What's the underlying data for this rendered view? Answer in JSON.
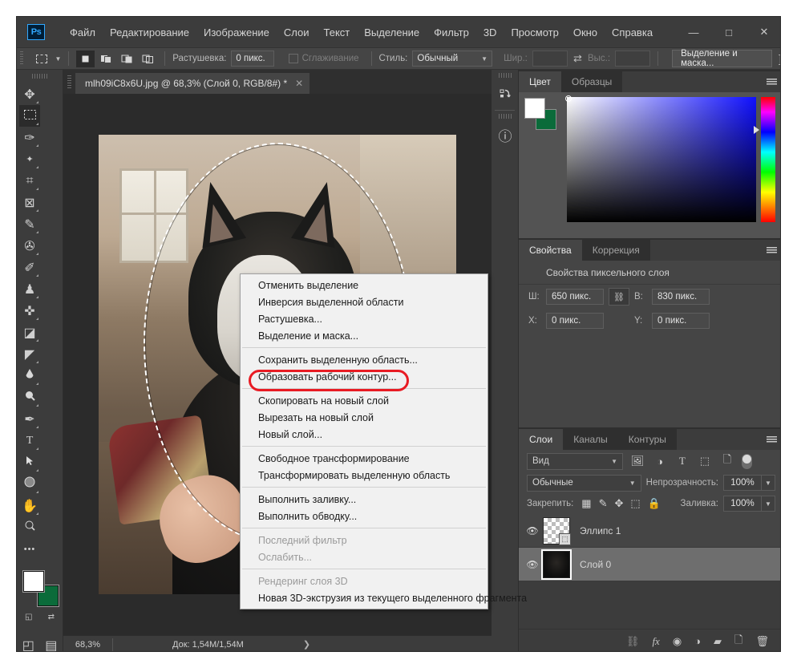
{
  "window": {
    "app_name": "Ps",
    "minimize": "—",
    "maximize": "□",
    "close": "✕"
  },
  "menubar": {
    "items": [
      "Файл",
      "Редактирование",
      "Изображение",
      "Слои",
      "Текст",
      "Выделение",
      "Фильтр",
      "3D",
      "Просмотр",
      "Окно",
      "Справка"
    ]
  },
  "options_bar": {
    "feather_label": "Растушевка:",
    "feather_value": "0 пикс.",
    "antialias_label": "Сглаживание",
    "style_label": "Стиль:",
    "style_value": "Обычный",
    "width_label": "Шир.:",
    "width_value": "",
    "height_label": "Выс.:",
    "height_value": "",
    "select_mask_button": "Выделение и маска...",
    "swap_icon": "⇄"
  },
  "toolbox": {
    "tools": [
      {
        "name": "move-tool",
        "glyph": "✥"
      },
      {
        "name": "rectangular-marquee-tool",
        "glyph": "▭",
        "active": true
      },
      {
        "name": "lasso-tool",
        "glyph": "✑"
      },
      {
        "name": "quick-selection-tool",
        "glyph": "✨"
      },
      {
        "name": "crop-tool",
        "glyph": "⌗"
      },
      {
        "name": "frame-tool",
        "glyph": "⊠"
      },
      {
        "name": "eyedropper-tool",
        "glyph": "✎"
      },
      {
        "name": "healing-brush-tool",
        "glyph": "✇"
      },
      {
        "name": "pencil-tool",
        "glyph": "✐"
      },
      {
        "name": "clone-stamp-tool",
        "glyph": "♟"
      },
      {
        "name": "history-brush-tool",
        "glyph": "✜"
      },
      {
        "name": "eraser-tool",
        "glyph": "◪"
      },
      {
        "name": "paint-bucket-tool",
        "glyph": "◤"
      },
      {
        "name": "blur-tool",
        "glyph": "💧"
      },
      {
        "name": "dodge-tool",
        "glyph": "🔍"
      },
      {
        "name": "pen-tool",
        "glyph": "✒"
      },
      {
        "name": "type-tool",
        "glyph": "T"
      },
      {
        "name": "path-selection-tool",
        "glyph": "➤"
      },
      {
        "name": "ellipse-tool",
        "glyph": "⬭"
      },
      {
        "name": "hand-tool",
        "glyph": "✋"
      },
      {
        "name": "zoom-tool",
        "glyph": "⚲"
      },
      {
        "name": "edit-toolbar-tool",
        "glyph": "•••"
      }
    ],
    "foreground_color": "#ffffff",
    "background_color": "#0b6b3a",
    "quickmask_glyph": "◰",
    "screenmode_glyph": "▤"
  },
  "document": {
    "tab_title": "mlh09iC8x6U.jpg @ 68,3% (Слой 0, RGB/8#) *",
    "tab_close": "✕"
  },
  "statusbar": {
    "zoom": "68,3%",
    "doc_info": "Док: 1,54M/1,54M",
    "expand_arrow": "❯"
  },
  "rail": {
    "buttons": [
      {
        "name": "history-rail-icon",
        "glyph": "↺"
      },
      {
        "name": "info-rail-icon",
        "glyph": "ⓘ"
      }
    ]
  },
  "color_panel": {
    "tabs": [
      {
        "label": "Цвет",
        "active": true
      },
      {
        "label": "Образцы",
        "active": false
      }
    ],
    "menu_icon": "hamburger-icon",
    "foreground": "#ffffff",
    "background": "#0b6b3a"
  },
  "properties_panel": {
    "tabs": [
      {
        "label": "Свойства",
        "active": true
      },
      {
        "label": "Коррекция",
        "active": false
      }
    ],
    "title": "Свойства пиксельного слоя",
    "width_label": "Ш:",
    "width_value": "650 пикс.",
    "link_glyph": "⛓",
    "height_label": "В:",
    "height_value": "830 пикс.",
    "x_label": "X:",
    "x_value": "0 пикс.",
    "y_label": "Y:",
    "y_value": "0 пикс."
  },
  "layers_panel": {
    "tabs": [
      {
        "label": "Слои",
        "active": true
      },
      {
        "label": "Каналы",
        "active": false
      },
      {
        "label": "Контуры",
        "active": false
      }
    ],
    "filter_label": "Вид",
    "filter_icons": [
      "image-filter-icon",
      "adjustment-filter-icon",
      "type-filter-icon",
      "shape-filter-icon",
      "smartobject-filter-icon"
    ],
    "blend_mode": "Обычные",
    "opacity_label": "Непрозрачность:",
    "opacity_value": "100%",
    "lock_label": "Закрепить:",
    "lock_icons": [
      "transparency-lock-icon",
      "image-lock-icon",
      "position-lock-icon",
      "artboard-lock-icon",
      "all-lock-icon"
    ],
    "fill_label": "Заливка:",
    "fill_value": "100%",
    "layers": [
      {
        "name": "Эллипс 1",
        "visible": true,
        "selected": false,
        "thumb": "checker",
        "badge": "⬚"
      },
      {
        "name": "Слой 0",
        "visible": true,
        "selected": true,
        "thumb": "photo",
        "badge": ""
      }
    ],
    "footer_icons": [
      {
        "name": "link-layers-icon",
        "glyph": "⛓"
      },
      {
        "name": "layer-style-icon",
        "glyph": "fx"
      },
      {
        "name": "layer-mask-icon",
        "glyph": "◉"
      },
      {
        "name": "adjustment-layer-icon",
        "glyph": "◑"
      },
      {
        "name": "new-group-icon",
        "glyph": "▰"
      },
      {
        "name": "new-layer-icon",
        "glyph": "🗋"
      },
      {
        "name": "delete-layer-icon",
        "glyph": "🗑"
      }
    ]
  },
  "context_menu": {
    "items": [
      {
        "label": "Отменить выделение",
        "disabled": false,
        "highlighted": false
      },
      {
        "label": "Инверсия выделенной области",
        "disabled": false,
        "highlighted": false
      },
      {
        "label": "Растушевка...",
        "disabled": false,
        "highlighted": false
      },
      {
        "label": "Выделение и маска...",
        "disabled": false,
        "highlighted": false
      },
      {
        "separator": true
      },
      {
        "label": "Сохранить выделенную область...",
        "disabled": false,
        "highlighted": false
      },
      {
        "label": "Образовать рабочий контур...",
        "disabled": false,
        "highlighted": false
      },
      {
        "separator": true
      },
      {
        "label": "Скопировать на новый слой",
        "disabled": false,
        "highlighted": true
      },
      {
        "label": "Вырезать на новый слой",
        "disabled": false,
        "highlighted": false
      },
      {
        "label": "Новый слой...",
        "disabled": false,
        "highlighted": false
      },
      {
        "separator": true
      },
      {
        "label": "Свободное трансформирование",
        "disabled": false,
        "highlighted": false
      },
      {
        "label": "Трансформировать выделенную область",
        "disabled": false,
        "highlighted": false
      },
      {
        "separator": true
      },
      {
        "label": "Выполнить заливку...",
        "disabled": false,
        "highlighted": false
      },
      {
        "label": "Выполнить обводку...",
        "disabled": false,
        "highlighted": false
      },
      {
        "separator": true
      },
      {
        "label": "Последний фильтр",
        "disabled": true,
        "highlighted": false
      },
      {
        "label": "Ослабить...",
        "disabled": true,
        "highlighted": false
      },
      {
        "separator": true
      },
      {
        "label": "Рендеринг слоя 3D",
        "disabled": true,
        "highlighted": false
      },
      {
        "label": "Новая 3D-экструзия из текущего выделенного фрагмента",
        "disabled": false,
        "highlighted": false
      }
    ],
    "highlight_color": "#e81b23"
  }
}
